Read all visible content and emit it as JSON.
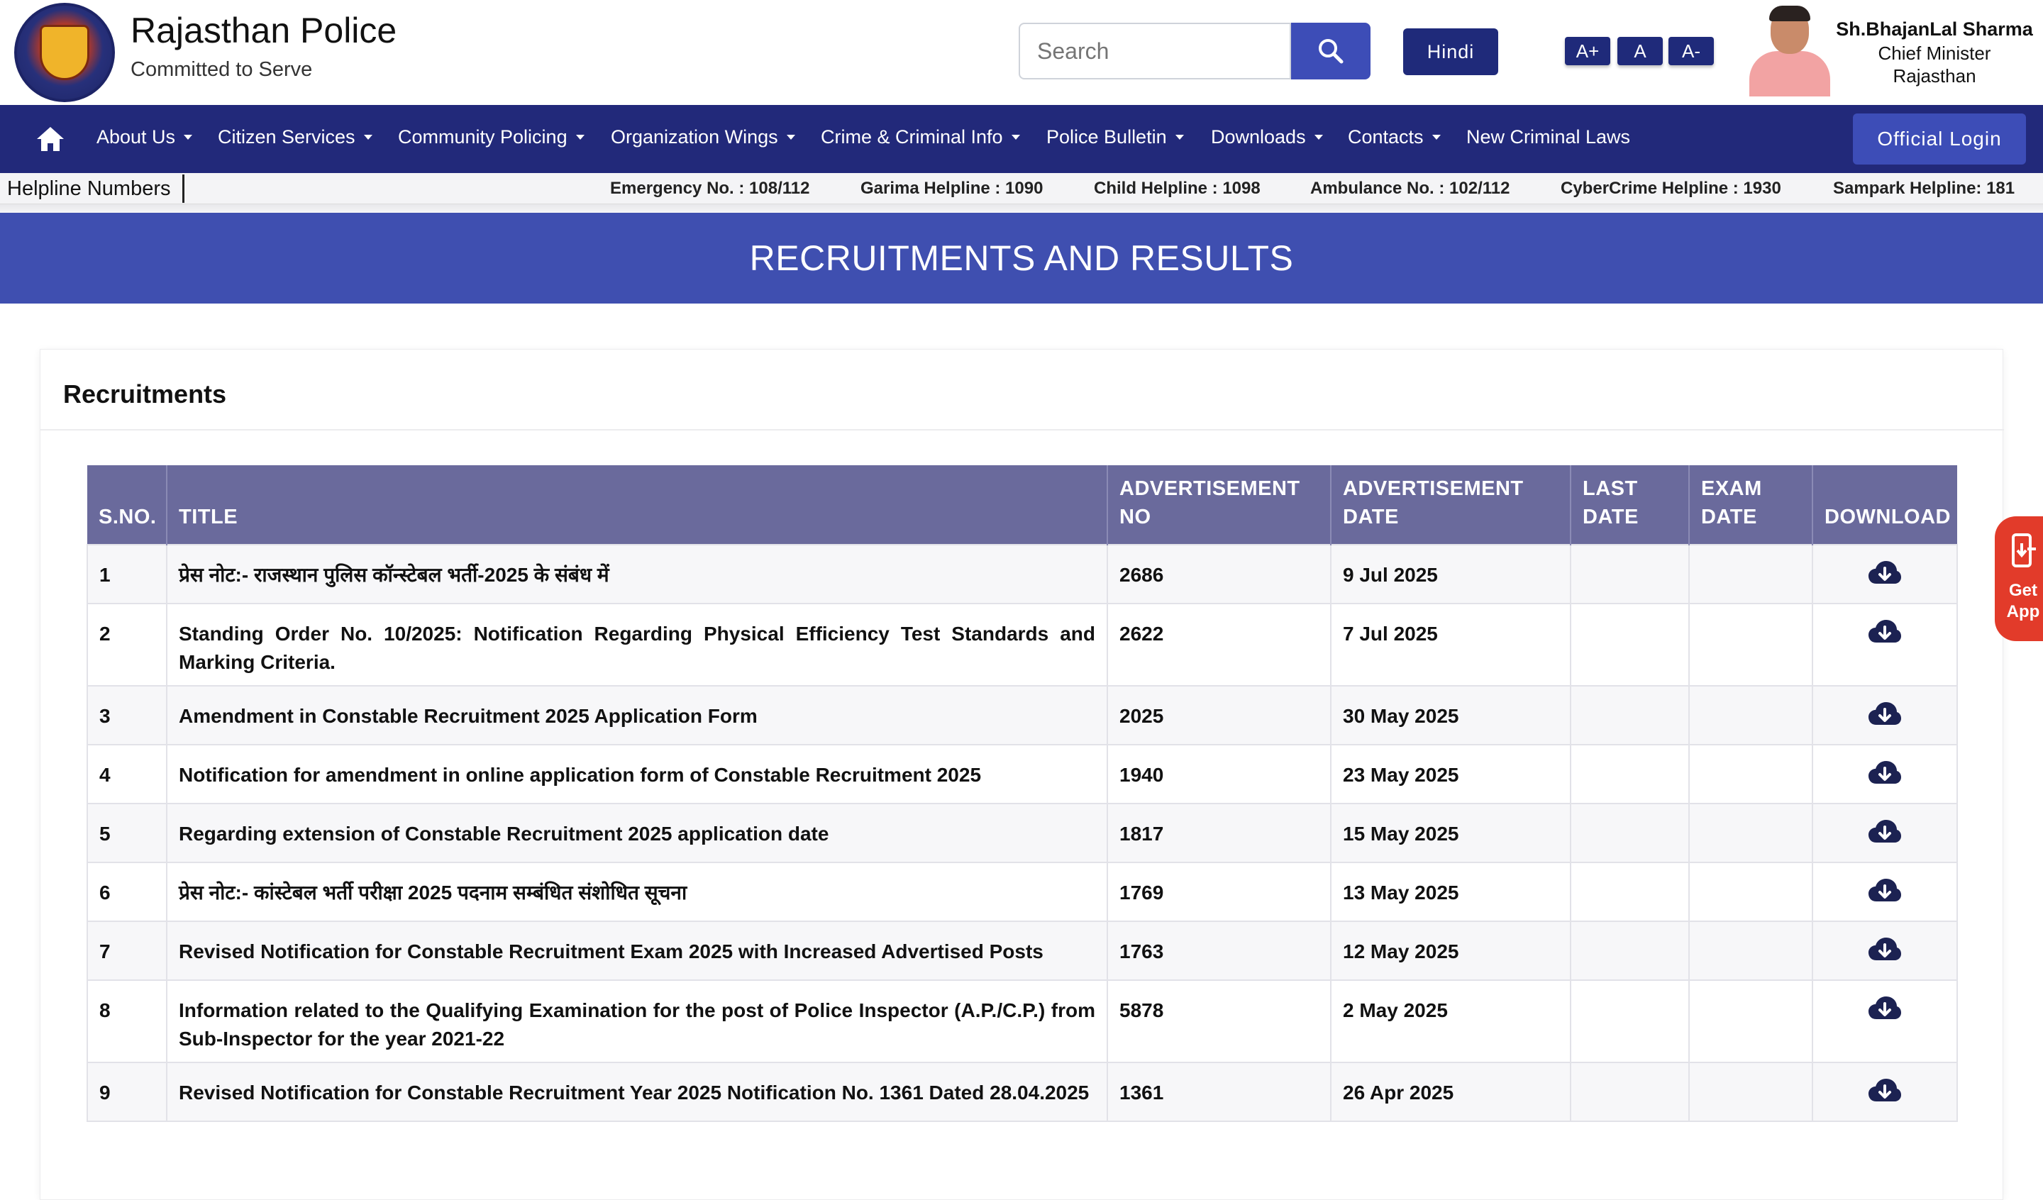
{
  "header": {
    "title": "Rajasthan Police",
    "subtitle": "Committed to Serve",
    "search_placeholder": "Search",
    "hindi_label": "Hindi",
    "font_sizes": [
      "A+",
      "A",
      "A-"
    ],
    "cm_name": "Sh.BhajanLal Sharma",
    "cm_role": "Chief Minister",
    "cm_state": "Rajasthan"
  },
  "nav": {
    "items": [
      "About Us",
      "Citizen Services",
      "Community Policing",
      "Organization Wings",
      "Crime & Criminal Info",
      "Police Bulletin",
      "Downloads",
      "Contacts",
      "New Criminal Laws"
    ],
    "login_label": "Official Login"
  },
  "helpline": {
    "label": "Helpline Numbers",
    "items": [
      "Emergency No. : 108/112",
      "Garima Helpline : 1090",
      "Child Helpline : 1098",
      "Ambulance No. : 102/112",
      "CyberCrime Helpline : 1930",
      "Sampark Helpline: 181"
    ]
  },
  "banner": {
    "title": "RECRUITMENTS AND RESULTS"
  },
  "section": {
    "title": "Recruitments"
  },
  "table": {
    "headers": {
      "sno": "S.NO.",
      "title": "TITLE",
      "adv_no": "ADVERTISEMENT NO",
      "adv_date": "ADVERTISEMENT DATE",
      "last_date": "LAST DATE",
      "exam_date": "EXAM DATE",
      "download": "DOWNLOAD"
    },
    "rows": [
      {
        "sno": "1",
        "title": "प्रेस नोट:- राजस्थान पुलिस कॉन्स्टेबल भर्ती-2025 के संबंध में",
        "adv_no": "2686",
        "adv_date": "9 Jul 2025",
        "last_date": "",
        "exam_date": ""
      },
      {
        "sno": "2",
        "title": "Standing Order No. 10/2025: Notification Regarding Physical Efficiency Test Standards and Marking Criteria.",
        "adv_no": "2622",
        "adv_date": "7 Jul 2025",
        "last_date": "",
        "exam_date": ""
      },
      {
        "sno": "3",
        "title": "Amendment in Constable Recruitment 2025 Application Form",
        "adv_no": "2025",
        "adv_date": "30 May 2025",
        "last_date": "",
        "exam_date": ""
      },
      {
        "sno": "4",
        "title": "Notification for amendment in online application form of Constable Recruitment 2025",
        "adv_no": "1940",
        "adv_date": "23 May 2025",
        "last_date": "",
        "exam_date": ""
      },
      {
        "sno": "5",
        "title": "Regarding extension of Constable Recruitment 2025 application date",
        "adv_no": "1817",
        "adv_date": "15 May 2025",
        "last_date": "",
        "exam_date": ""
      },
      {
        "sno": "6",
        "title": "प्रेस नोट:- कांस्टेबल भर्ती परीक्षा 2025 पदनाम सम्बंधित संशोधित सूचना",
        "adv_no": "1769",
        "adv_date": "13 May 2025",
        "last_date": "",
        "exam_date": ""
      },
      {
        "sno": "7",
        "title": "Revised Notification for Constable Recruitment Exam 2025 with Increased Advertised Posts",
        "adv_no": "1763",
        "adv_date": "12 May 2025",
        "last_date": "",
        "exam_date": ""
      },
      {
        "sno": "8",
        "title": "Information related to the Qualifying Examination for the post of Police Inspector (A.P./C.P.) from Sub-Inspector for the year 2021-22",
        "adv_no": "5878",
        "adv_date": "2 May 2025",
        "last_date": "",
        "exam_date": ""
      },
      {
        "sno": "9",
        "title": "Revised Notification for Constable Recruitment Year 2025 Notification No. 1361 Dated 28.04.2025",
        "adv_no": "1361",
        "adv_date": "26 Apr 2025",
        "last_date": "",
        "exam_date": ""
      }
    ]
  },
  "get_app": {
    "line1": "Get",
    "line2": "App"
  },
  "icons": {
    "search": "magnifier-icon",
    "home": "home-icon",
    "download": "cloud-download-icon",
    "app": "mobile-download-icon",
    "caret": "chevron-down-icon"
  },
  "colors": {
    "nav_bg": "#22297a",
    "banner_bg": "#3f4fb0",
    "table_header_bg": "#6a6a9c",
    "accent_button": "#3d4db7",
    "get_app_bg": "#e23b2a"
  }
}
